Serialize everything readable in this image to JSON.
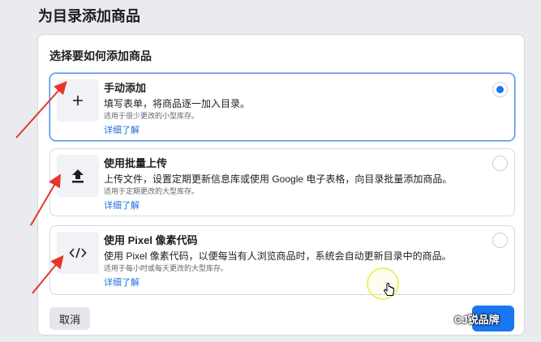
{
  "header": {
    "title": "为目录添加商品"
  },
  "panel": {
    "title": "选择要如何添加商品",
    "options": [
      {
        "title": "手动添加",
        "desc": "填写表单，将商品逐一加入目录。",
        "hint": "适用于很少更改的小型库存。",
        "link": "详细了解",
        "icon": "plus-icon",
        "selected": true
      },
      {
        "title": "使用批量上传",
        "desc": "上传文件，设置定期更新信息库或使用 Google 电子表格，向目录批量添加商品。",
        "hint": "适用于定期更改的大型库存。",
        "link": "详细了解",
        "icon": "upload-icon",
        "selected": false
      },
      {
        "title": "使用 Pixel 像素代码",
        "desc": "使用 Pixel 像素代码，以便每当有人浏览商品时，系统会自动更新目录中的商品。",
        "hint": "适用于每小时或每天更改的大型库存。",
        "link": "详细了解",
        "icon": "code-icon",
        "selected": false
      }
    ]
  },
  "footer": {
    "cancel_label": "取消"
  },
  "watermark": {
    "text": "CJ锐品牌"
  },
  "colors": {
    "accent": "#1877f2",
    "link": "#216fdb",
    "annotation": "#e8352b"
  }
}
